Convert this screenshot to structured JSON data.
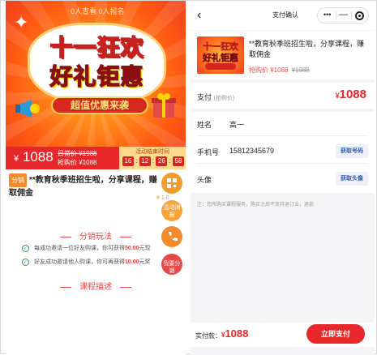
{
  "left": {
    "banner": {
      "stats": "0人查看  0人报名",
      "title_line1": "十一狂欢",
      "title_line2": "好礼钜惠",
      "pill": "超值优惠来袭"
    },
    "pricebar": {
      "currency": "¥",
      "price": "1088",
      "orig": "日常价 ¥1988",
      "grab": "抢购价 ¥1088",
      "countdown_label": "活动结束时间",
      "d": "16",
      "h": "12",
      "m": "26",
      "s": "58"
    },
    "product": {
      "tag": "分销",
      "title": "**教育秋季班招生啦，分享课程，赚取佣金"
    },
    "float": {
      "activity": "活动海报",
      "distribute": "我要分销",
      "peek": "¥ 1.0"
    },
    "sections": {
      "distribution_title": "分销玩法",
      "rule1_pre": "每成功邀请一位好友购课，你可获得",
      "rule1_amt": "50.00",
      "rule1_post": "元现",
      "rule2_pre": "好友成功邀请他人购课，你可再获得",
      "rule2_amt": "10.00",
      "rule2_post": "元奖",
      "course_title": "课程描述"
    }
  },
  "right": {
    "nav": {
      "back": "‹",
      "title": "支付确认"
    },
    "card": {
      "name": "**教育秋季班招生啦，分享课程，赚取佣金",
      "price": "抢购价 ¥1088",
      "orig": "¥1988"
    },
    "pay": {
      "label": "支付",
      "sub": "(抢购价)",
      "currency": "¥",
      "amount": "1088"
    },
    "form": {
      "name_label": "姓名",
      "name_value": "高一",
      "phone_label": "手机号",
      "phone_value": "15812345679",
      "phone_btn": "获取号码",
      "avatar_label": "头像",
      "avatar_btn": "获取头像"
    },
    "note": "注：您所购买课程服务，购买之后不支持退订业，退款",
    "bottom": {
      "label": "实付款：",
      "currency": "¥",
      "amount": "1088",
      "pay_btn": "立即支付"
    }
  },
  "colors": {
    "accent_red": "#e8272b",
    "orange": "#f39c2d",
    "link_blue": "#2c5bb5"
  }
}
